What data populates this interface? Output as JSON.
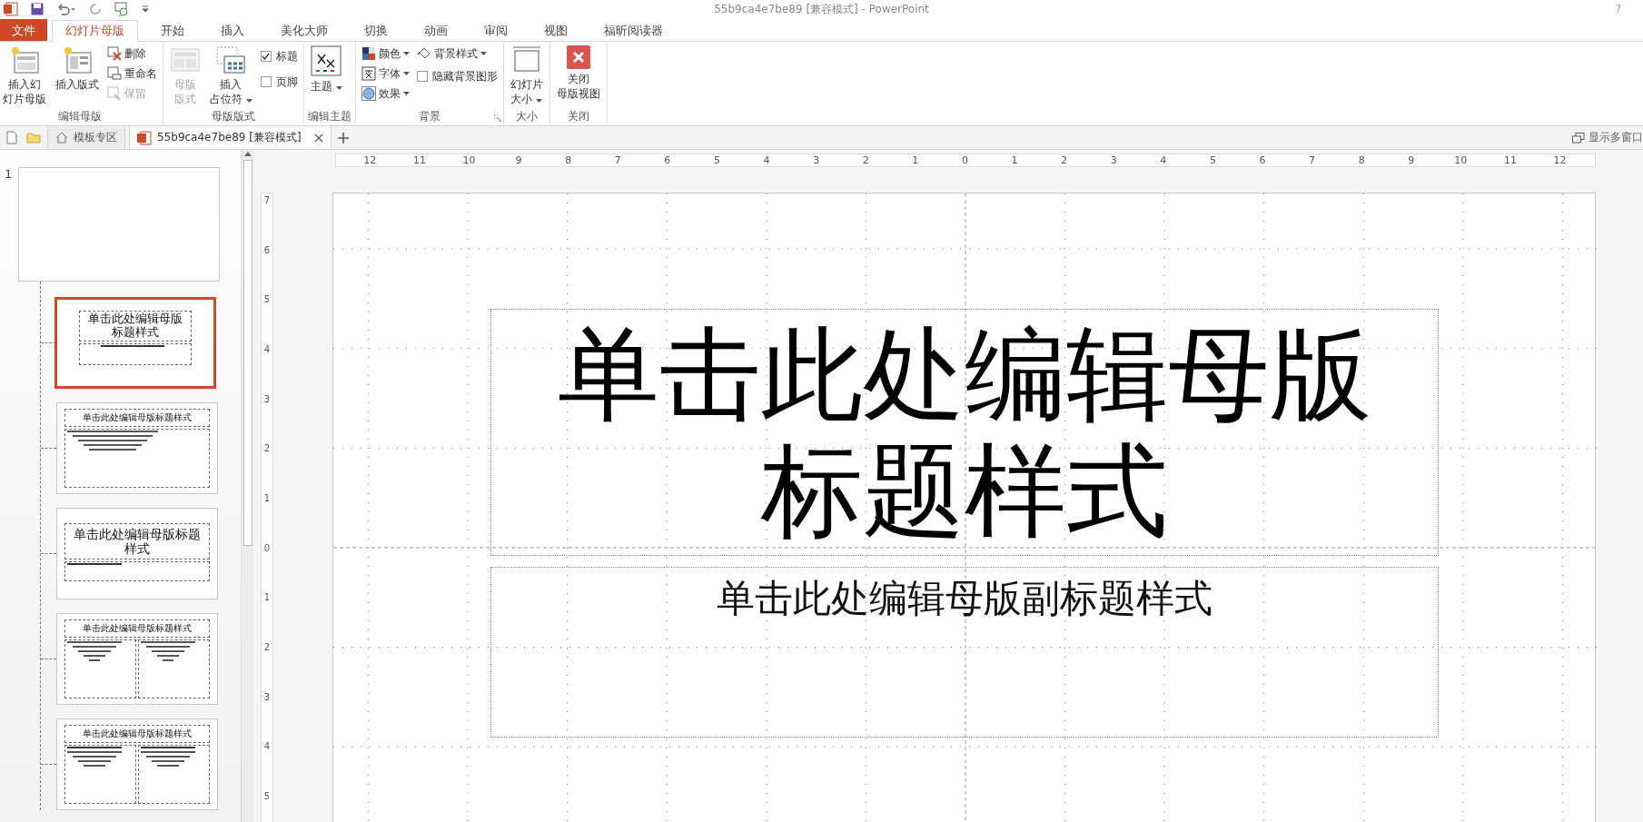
{
  "title_bar": {
    "title": "55b9ca4e7be89 [兼容模式] - PowerPoint",
    "help": "?"
  },
  "ribbon_tabs": [
    {
      "label": "文件",
      "kind": "file",
      "selected": false
    },
    {
      "label": "幻灯片母版",
      "kind": "tab",
      "selected": true
    },
    {
      "label": "开始",
      "kind": "tab",
      "selected": false
    },
    {
      "label": "插入",
      "kind": "tab",
      "selected": false
    },
    {
      "label": "美化大师",
      "kind": "tab",
      "selected": false
    },
    {
      "label": "切换",
      "kind": "tab",
      "selected": false
    },
    {
      "label": "动画",
      "kind": "tab",
      "selected": false
    },
    {
      "label": "审阅",
      "kind": "tab",
      "selected": false
    },
    {
      "label": "视图",
      "kind": "tab",
      "selected": false
    },
    {
      "label": "福昕阅读器",
      "kind": "tab",
      "selected": false
    }
  ],
  "ribbon_groups": [
    {
      "label": "编辑母版",
      "items": [
        {
          "kind": "large",
          "lines": [
            "插入幻",
            "灯片母版"
          ],
          "disabled": false,
          "dropdown": false
        },
        {
          "kind": "large",
          "lines": [
            "插入版式"
          ],
          "disabled": false,
          "dropdown": false
        },
        {
          "kind": "stack",
          "items": [
            {
              "kind": "small",
              "label": "删除",
              "disabled": false,
              "dropdown": false
            },
            {
              "kind": "small",
              "label": "重命名",
              "disabled": false,
              "dropdown": false
            },
            {
              "kind": "small",
              "label": "保留",
              "disabled": true,
              "dropdown": false
            }
          ]
        }
      ]
    },
    {
      "label": "母版版式",
      "items": [
        {
          "kind": "large",
          "lines": [
            "母版",
            "版式"
          ],
          "disabled": true,
          "dropdown": false
        },
        {
          "kind": "large",
          "lines": [
            "插入",
            "占位符"
          ],
          "disabled": false,
          "dropdown": true
        },
        {
          "kind": "stack",
          "items": [
            {
              "kind": "checkbox",
              "label": "标题",
              "checked": true
            },
            {
              "kind": "checkbox",
              "label": "页脚",
              "checked": false
            }
          ]
        }
      ]
    },
    {
      "label": "编辑主题",
      "items": [
        {
          "kind": "large",
          "lines": [
            "主题"
          ],
          "disabled": false,
          "dropdown": true
        }
      ]
    },
    {
      "label": "背景",
      "launcher": true,
      "items": [
        {
          "kind": "stack",
          "items": [
            {
              "kind": "small",
              "label": "颜色",
              "disabled": false,
              "dropdown": true
            },
            {
              "kind": "small",
              "label": "字体",
              "disabled": false,
              "dropdown": true
            },
            {
              "kind": "small",
              "label": "效果",
              "disabled": false,
              "dropdown": true
            }
          ]
        },
        {
          "kind": "stack",
          "items": [
            {
              "kind": "small",
              "label": "背景样式",
              "disabled": false,
              "dropdown": true
            },
            {
              "kind": "checkbox",
              "label": "隐藏背景图形",
              "checked": false
            }
          ]
        }
      ]
    },
    {
      "label": "大小",
      "items": [
        {
          "kind": "large",
          "lines": [
            "幻灯片",
            "大小"
          ],
          "disabled": false,
          "dropdown": true
        }
      ]
    },
    {
      "label": "关闭",
      "items": [
        {
          "kind": "large",
          "lines": [
            "关闭",
            "母版视图"
          ],
          "disabled": false,
          "dropdown": false
        }
      ]
    }
  ],
  "doc_tabs": [
    {
      "label": "模板专区",
      "kind": "home",
      "selected": false
    },
    {
      "label": "55b9ca4e7be89 [兼容模式]",
      "kind": "doc",
      "selected": true
    }
  ],
  "show_windows": "显示多窗口",
  "thumbnails": [
    {
      "kind": "master",
      "number": "1",
      "selected": false
    },
    {
      "kind": "title",
      "title": "单击此处编辑母版标题样式",
      "selected": true
    },
    {
      "kind": "content",
      "title": "单击此处编辑母版标题样式",
      "selected": false
    },
    {
      "kind": "section",
      "title": "单击此处编辑母版标题样式",
      "selected": false
    },
    {
      "kind": "two_content",
      "title": "单击此处编辑母版标题样式",
      "selected": false
    },
    {
      "kind": "comparison",
      "title": "单击此处编辑母版标题样式",
      "selected": false
    }
  ],
  "ruler_h": [
    "12",
    "11",
    "10",
    "9",
    "8",
    "7",
    "6",
    "5",
    "4",
    "3",
    "2",
    "1",
    "0",
    "1",
    "2",
    "3",
    "4",
    "5",
    "6",
    "7",
    "8",
    "9",
    "10",
    "11",
    "12"
  ],
  "ruler_v": [
    "7",
    "6",
    "5",
    "4",
    "3",
    "2",
    "1",
    "0",
    "1",
    "2",
    "3",
    "4",
    "5"
  ],
  "slide": {
    "title": "单击此处编辑母版标题样式",
    "subtitle": "单击此处编辑母版副标题样式"
  }
}
